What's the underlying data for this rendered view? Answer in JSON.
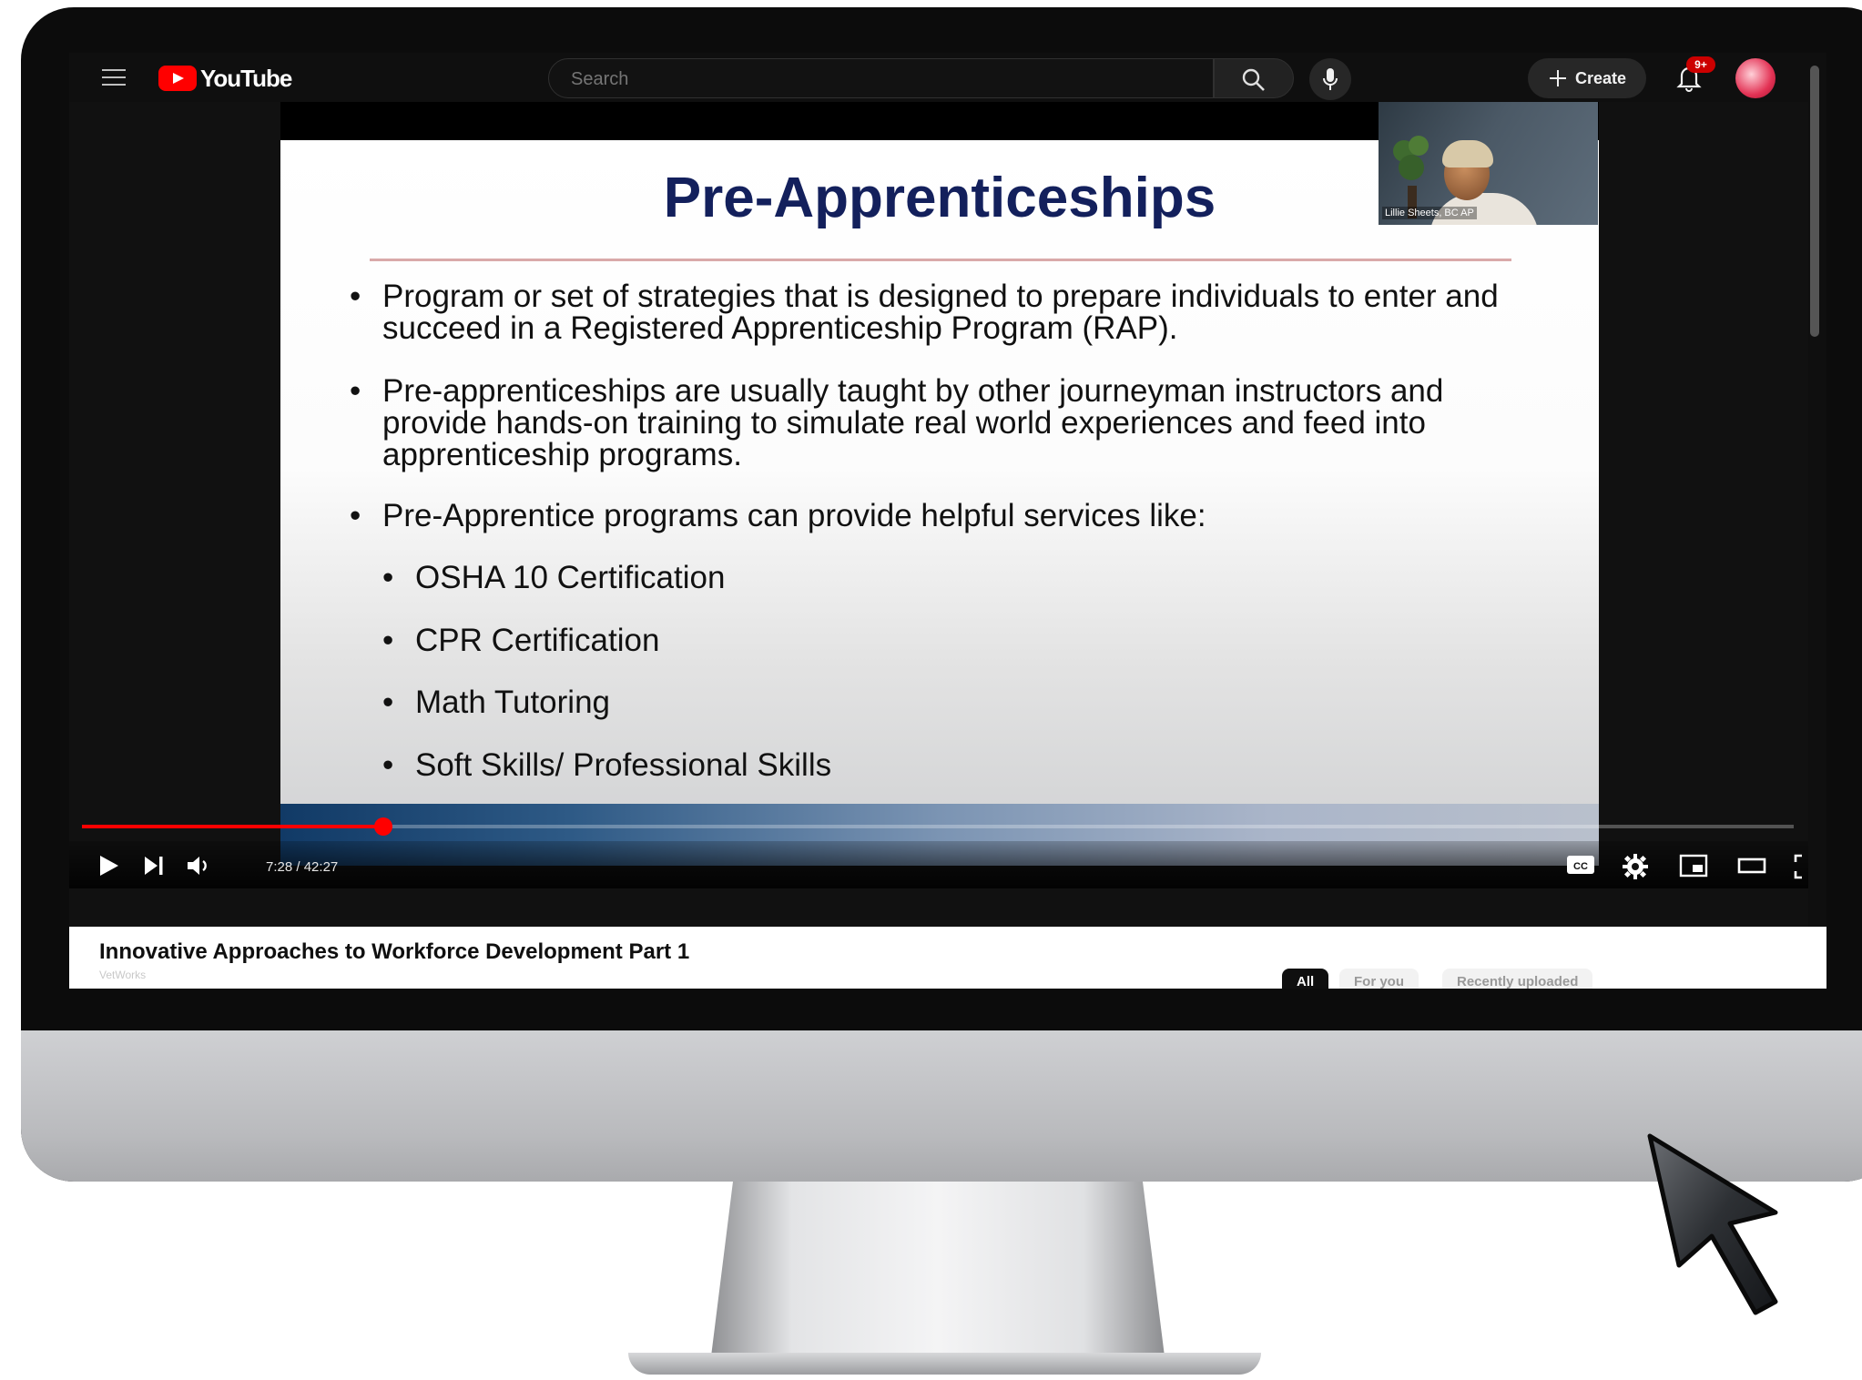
{
  "masthead": {
    "logo_text": "YouTube",
    "search_placeholder": "Search",
    "create_label": "Create",
    "notification_count": "9+"
  },
  "slide": {
    "title": "Pre-Apprenticeships",
    "bullets": [
      "Program or set of strategies that is designed to prepare individuals to enter and succeed in a Registered Apprenticeship Program (RAP).",
      "Pre-apprenticeships are usually taught by other journeyman instructors and provide hands-on training to simulate real world experiences and feed into apprenticeship programs.",
      "Pre-Apprentice programs can provide helpful services like:"
    ],
    "sub_bullets": [
      "OSHA 10 Certification",
      "CPR Certification",
      "Math Tutoring",
      "Soft Skills/ Professional Skills"
    ],
    "bullet_glyph": "•",
    "webcam_name": "Lillie Sheets, BC AP"
  },
  "player": {
    "current_time": "7:28",
    "separator": "/",
    "duration": "42:27",
    "progress": 0.176,
    "accent_color": "#ff0000"
  },
  "video": {
    "title": "Innovative Approaches to Workforce Development Part 1",
    "channel": "VetWorks"
  },
  "chips": [
    "All",
    "For you",
    "Recently uploaded"
  ],
  "icons": [
    "menu-icon",
    "youtube-logo-icon",
    "search-icon",
    "mic-icon",
    "plus-icon",
    "bell-icon",
    "play-icon",
    "next-icon",
    "volume-icon",
    "captions-icon",
    "settings-icon",
    "miniplayer-icon",
    "theater-icon",
    "fullscreen-icon",
    "mouse-cursor-icon"
  ]
}
